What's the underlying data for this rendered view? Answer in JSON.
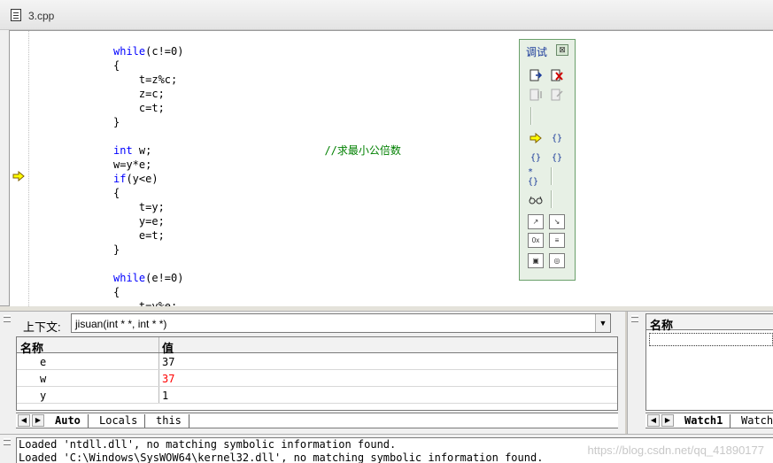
{
  "editor": {
    "tab_title": "3.cpp",
    "code_lines": [
      {
        "kw": "while",
        "rest": "(c!=0)",
        "comment": ""
      },
      {
        "kw": "",
        "rest": "{",
        "comment": ""
      },
      {
        "kw": "",
        "rest": "    t=z%c;",
        "comment": ""
      },
      {
        "kw": "",
        "rest": "    z=c;",
        "comment": ""
      },
      {
        "kw": "",
        "rest": "    c=t;",
        "comment": ""
      },
      {
        "kw": "",
        "rest": "}",
        "comment": ""
      },
      {
        "kw": "",
        "rest": "",
        "comment": ""
      },
      {
        "kw": "int",
        "rest": " w;                           ",
        "comment": "//求最小公倍数"
      },
      {
        "kw": "",
        "rest": "w=y*e;",
        "comment": ""
      },
      {
        "kw": "if",
        "rest": "(y<e)",
        "comment": ""
      },
      {
        "kw": "",
        "rest": "{",
        "comment": ""
      },
      {
        "kw": "",
        "rest": "    t=y;",
        "comment": ""
      },
      {
        "kw": "",
        "rest": "    y=e;",
        "comment": ""
      },
      {
        "kw": "",
        "rest": "    e=t;",
        "comment": ""
      },
      {
        "kw": "",
        "rest": "}",
        "comment": ""
      },
      {
        "kw": "",
        "rest": "",
        "comment": ""
      },
      {
        "kw": "while",
        "rest": "(e!=0)",
        "comment": ""
      },
      {
        "kw": "",
        "rest": "{",
        "comment": ""
      },
      {
        "kw": "",
        "rest": "    t=y%e;",
        "comment": ""
      }
    ]
  },
  "debug_toolbar": {
    "title": "调试",
    "close_label": "⊠"
  },
  "variables": {
    "context_label": "上下文:",
    "context_value": "jisuan(int * *, int * *)",
    "dropdown_glyph": "▼",
    "col_name": "名称",
    "col_value": "值",
    "rows": [
      {
        "name": "e",
        "value": "37",
        "changed": false
      },
      {
        "name": "w",
        "value": "37",
        "changed": true
      },
      {
        "name": "y",
        "value": "1",
        "changed": false
      }
    ],
    "tabs": [
      "Auto",
      "Locals",
      "this"
    ],
    "changed_color": "#ff0000"
  },
  "watch": {
    "col_name": "名称",
    "tabs": [
      "Watch1",
      "Watch"
    ]
  },
  "output": {
    "lines": [
      "Loaded 'ntdll.dll', no matching symbolic information found.",
      "Loaded 'C:\\Windows\\SysWOW64\\kernel32.dll', no matching symbolic information found."
    ],
    "watermark": "https://blog.csdn.net/qq_41890177"
  }
}
